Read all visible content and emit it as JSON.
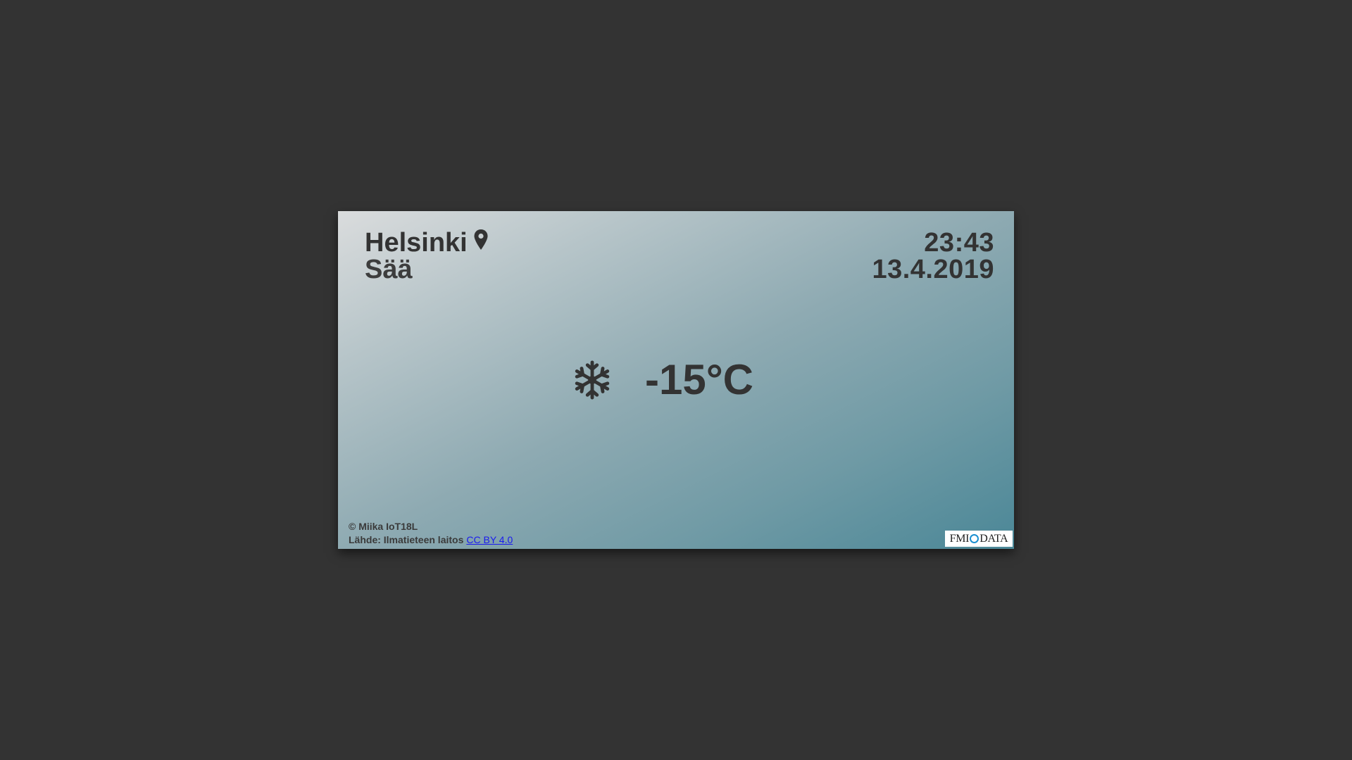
{
  "header": {
    "city": "Helsinki",
    "subtitle": "Sää",
    "time": "23:43",
    "date": "13.4.2019"
  },
  "weather": {
    "icon": "snowflake-icon",
    "temperature": "-15°C"
  },
  "footer": {
    "copyright": "© Miika IoT18L",
    "source_label": "Lähde: Ilmatieteen laitos",
    "license_link": "CC BY 4.0"
  },
  "logo": {
    "left_text": "FMI",
    "right_text": "DATA"
  },
  "colors": {
    "background": "#333333",
    "text": "#333333",
    "link": "#1a1aee",
    "logo_ring": "#1a8fd0"
  }
}
